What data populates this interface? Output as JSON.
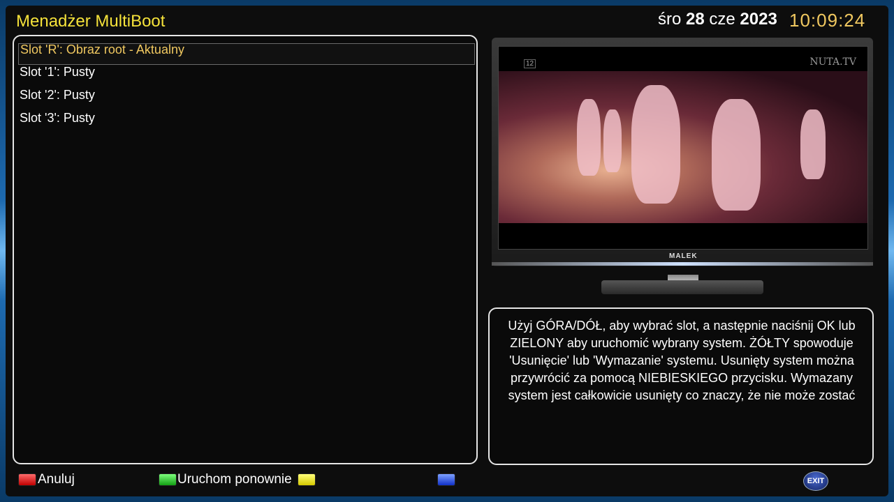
{
  "header": {
    "title": "Menadżer MultiBoot",
    "date_day": "śro",
    "date_num": "28",
    "date_month": "cze",
    "date_year": "2023",
    "time": "10:09:24"
  },
  "slots": [
    {
      "label": "Slot 'R': Obraz root  -  Aktualny",
      "selected": true
    },
    {
      "label": "Slot '1': Pusty",
      "selected": false
    },
    {
      "label": "Slot '2': Pusty",
      "selected": false
    },
    {
      "label": "Slot '3': Pusty",
      "selected": false
    }
  ],
  "preview": {
    "channel_badge": "12",
    "channel_logo": "NUTA.TV",
    "tv_brand": "MALEK"
  },
  "info": {
    "text": "Użyj GÓRA/DÓŁ, aby wybrać slot, a następnie naciśnij OK lub ZIELONY aby uruchomić wybrany system. ŻÓŁTY spowoduje 'Usunięcie' lub 'Wymazanie' systemu. Usunięty system można przywrócić za pomocą NIEBIESKIEGO przycisku. Wymazany system jest całkowicie usunięty co znaczy, że nie może zostać przywrócony!"
  },
  "buttons": {
    "red_label": "Anuluj",
    "green_label": "Uruchom ponownie",
    "yellow_label": "",
    "blue_label": "",
    "exit_label": "EXIT"
  },
  "colors": {
    "title": "#f5e23a",
    "clock": "#f0c860",
    "selected_text": "#f0c860",
    "red": "#d00000",
    "green": "#13a013",
    "yellow": "#d4c800",
    "blue": "#1030c8"
  }
}
